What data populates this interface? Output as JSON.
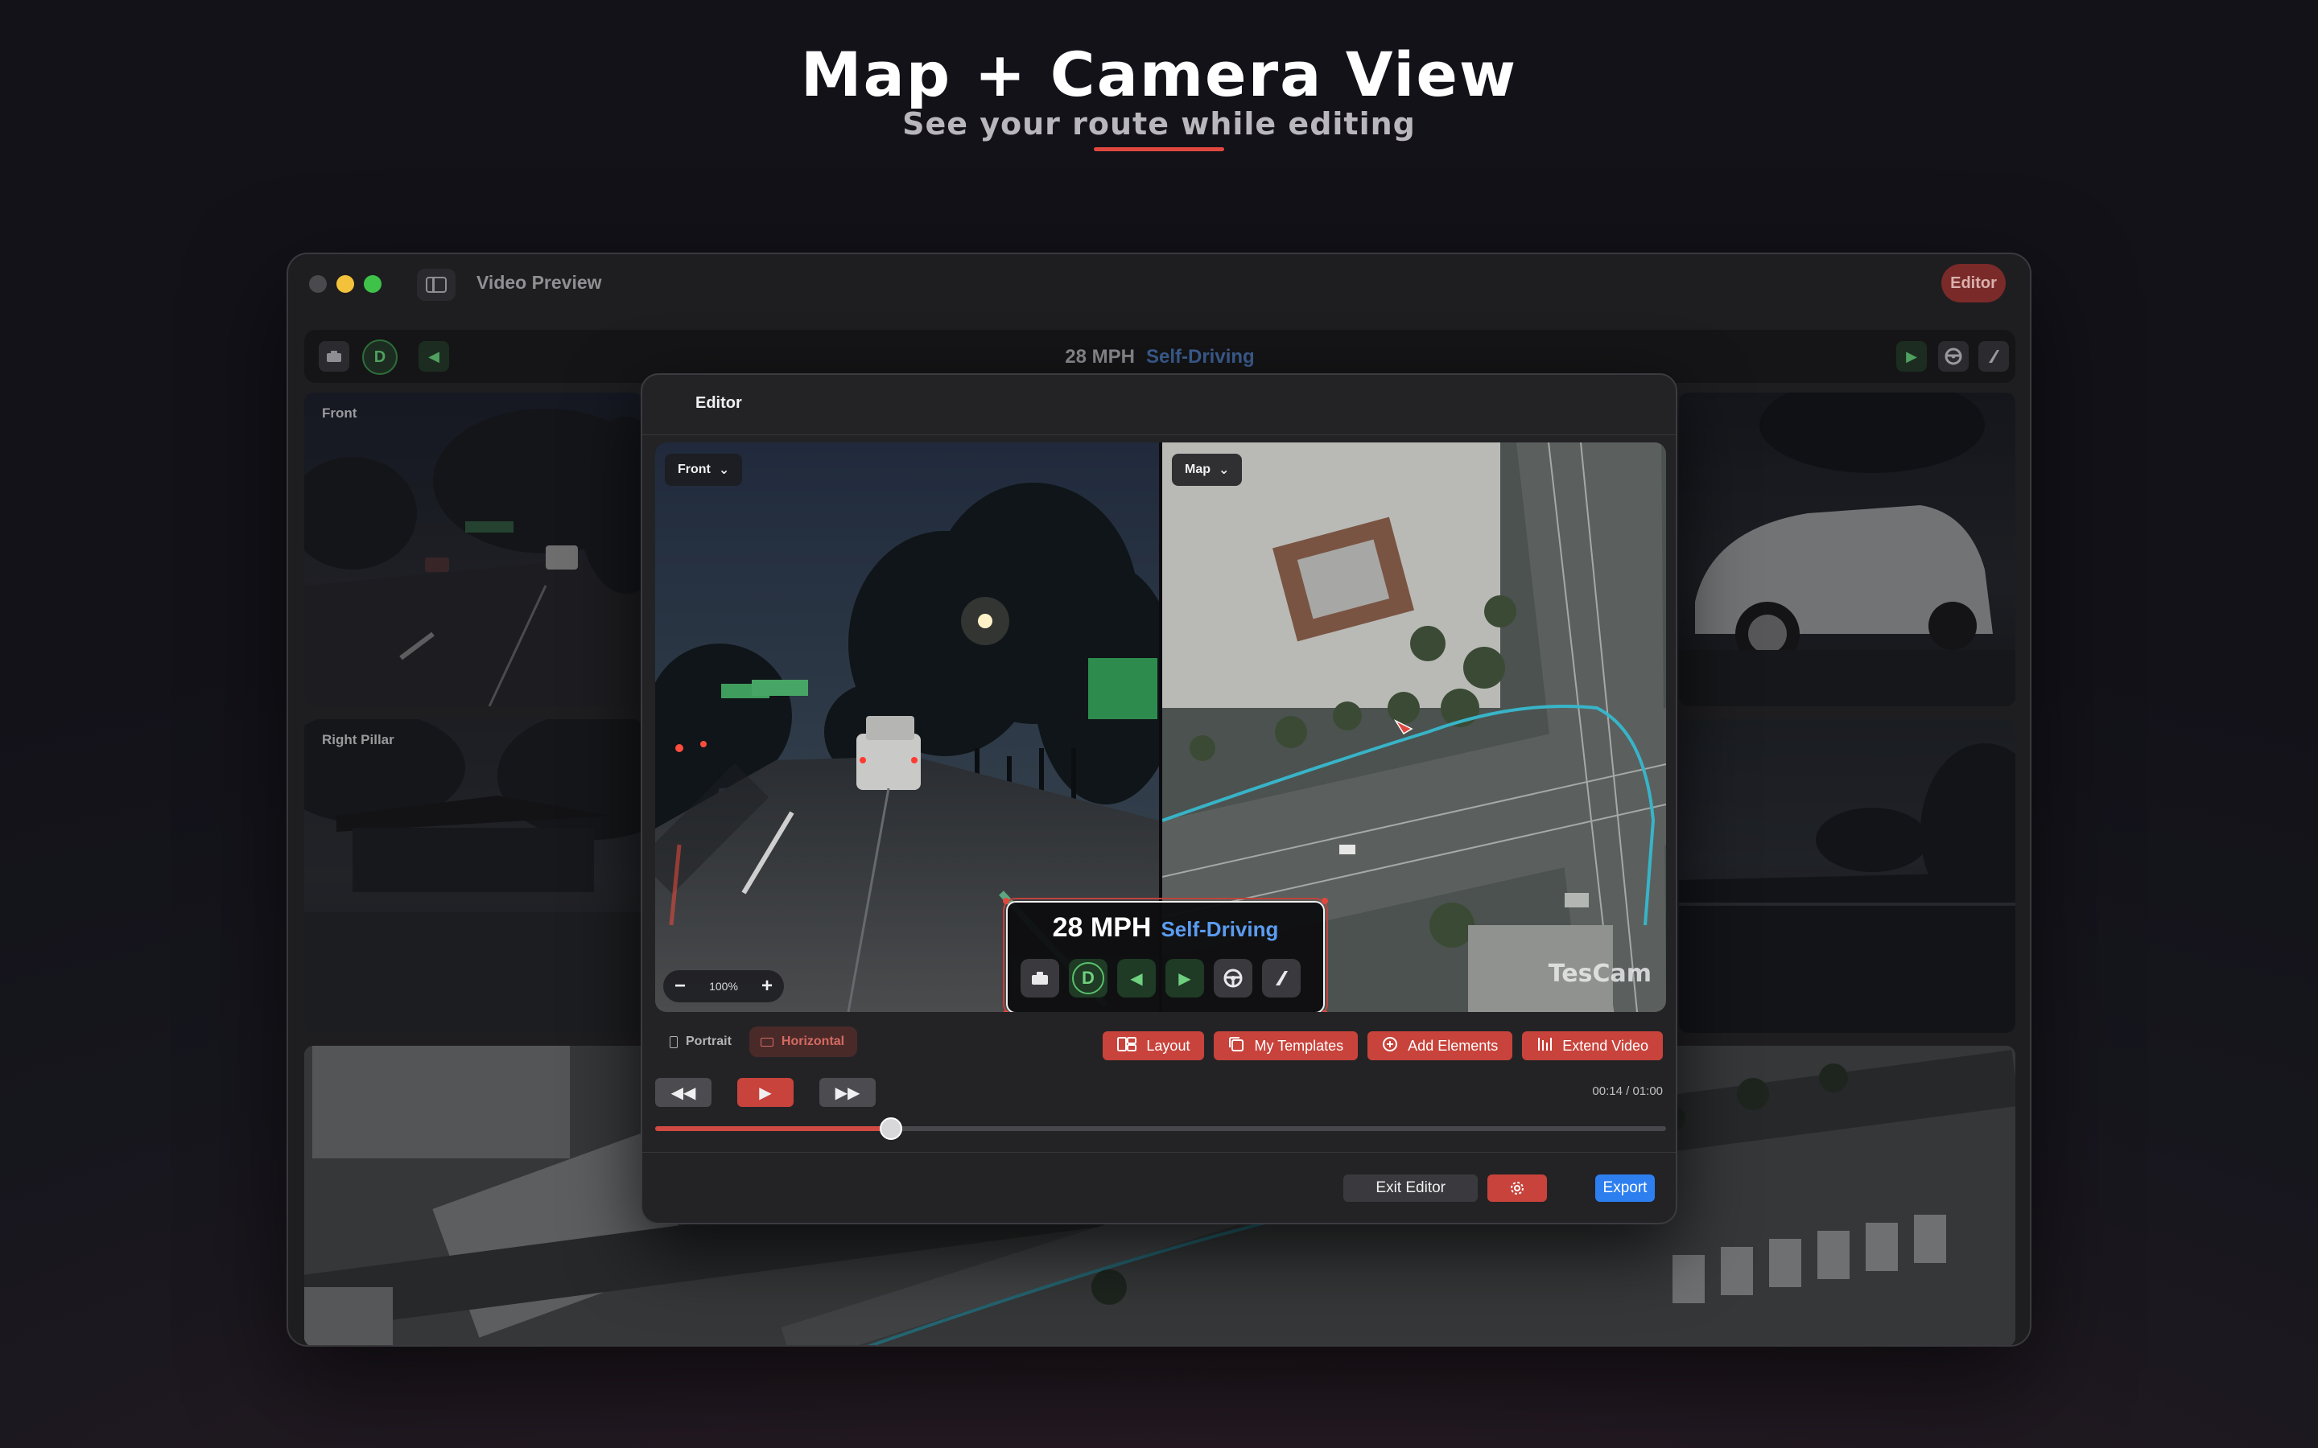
{
  "hero": {
    "title": "Map + Camera View",
    "subtitle": "See your route while editing"
  },
  "window": {
    "title": "Video Preview",
    "editor_badge": "Editor"
  },
  "background_app": {
    "speed": "28 MPH",
    "mode": "Self-Driving",
    "gear": "D",
    "tiles": {
      "front": "Front",
      "right_pillar": "Right Pillar"
    }
  },
  "editor": {
    "title": "Editor",
    "camera_select": "Front",
    "map_select": "Map",
    "zoom_level": "100%",
    "hud": {
      "speed": "28 MPH",
      "mode": "Self-Driving",
      "gear": "D"
    },
    "watermark": "TesCam",
    "orientation": {
      "portrait": "Portrait",
      "horizontal": "Horizontal"
    },
    "actions": {
      "layout": "Layout",
      "my_templates": "My Templates",
      "add_elements": "Add Elements",
      "extend_video": "Extend Video"
    },
    "timecode": "00:14 / 01:00",
    "progress_fraction": 0.233,
    "exit_label": "Exit Editor",
    "export_label": "Export"
  },
  "colors": {
    "accent": "#c8433b",
    "export_blue": "#2d7ff0",
    "mode_blue": "#5b9cf0",
    "gear_green": "#58c06a"
  }
}
